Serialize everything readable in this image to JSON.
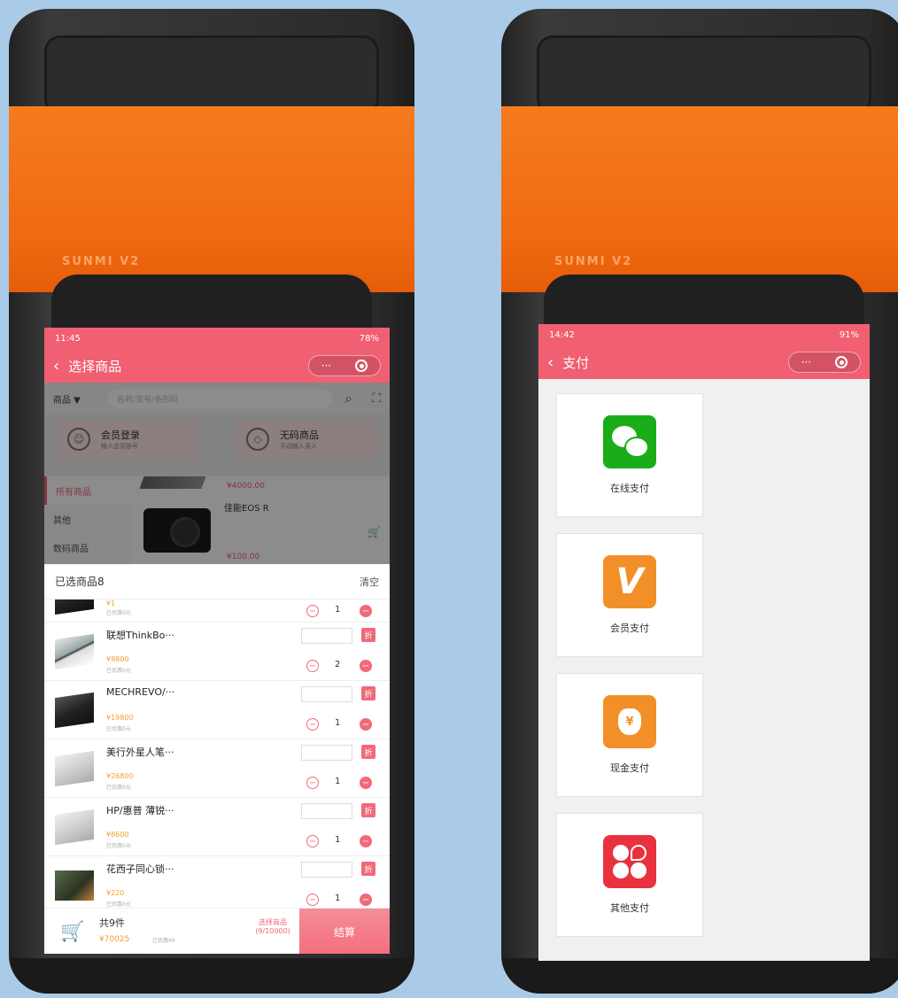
{
  "left": {
    "status": {
      "time": "11:45",
      "right": "78%"
    },
    "title": "选择商品",
    "capsule_more": "···",
    "search": {
      "dropdown": "商品 ▼",
      "placeholder": "名称/货号/条形码"
    },
    "quick_cards": [
      {
        "title": "会员登录",
        "sub": "输入会员账号"
      },
      {
        "title": "无码商品",
        "sub": "手动输入录入"
      }
    ],
    "categories": [
      "所有商品",
      "其他",
      "数码商品"
    ],
    "products": {
      "price_top": "¥4000.00",
      "name": "佳能EOS R",
      "price": "¥100.00"
    },
    "selected": {
      "title": "已选商品8",
      "clear": "清空"
    },
    "partial_item": {
      "price": "¥1",
      "sub": "已优惠0元",
      "qty": "1"
    },
    "items": [
      {
        "name": "联想ThinkBo···",
        "price": "¥8800",
        "sub": "已优惠0元",
        "qty": "2",
        "tag": "折"
      },
      {
        "name": "MECHREVO/···",
        "price": "¥19800",
        "sub": "已优惠0元",
        "qty": "1",
        "tag": "折"
      },
      {
        "name": "美行外星人笔···",
        "price": "¥26800",
        "sub": "已优惠0元",
        "qty": "1",
        "tag": "折"
      },
      {
        "name": "HP/惠普 薄锐···",
        "price": "¥8600",
        "sub": "已优惠0元",
        "qty": "1",
        "tag": "折"
      },
      {
        "name": "花西子同心锁···",
        "price": "¥220",
        "sub": "已优惠0元",
        "qty": "1",
        "tag": "折"
      }
    ],
    "footer": {
      "count": "共9件",
      "total": "¥70025",
      "discount": "已优惠¥0",
      "sel_label": "选择商品",
      "sel_value": "(9/10000)",
      "checkout": "结算"
    }
  },
  "right": {
    "status": {
      "time": "14:42",
      "right": "91%"
    },
    "title": "支付",
    "capsule_more": "···",
    "methods": [
      {
        "label": "在线支付",
        "icon": "wechat-icon"
      },
      {
        "label": "会员支付",
        "icon": "member-v-icon"
      },
      {
        "label": "现金支付",
        "icon": "cash-bag-icon"
      },
      {
        "label": "其他支付",
        "icon": "other-clover-icon"
      }
    ]
  },
  "colors": {
    "accent": "#f15f72",
    "orange": "#f57b1e",
    "wechat": "#1aad19"
  }
}
